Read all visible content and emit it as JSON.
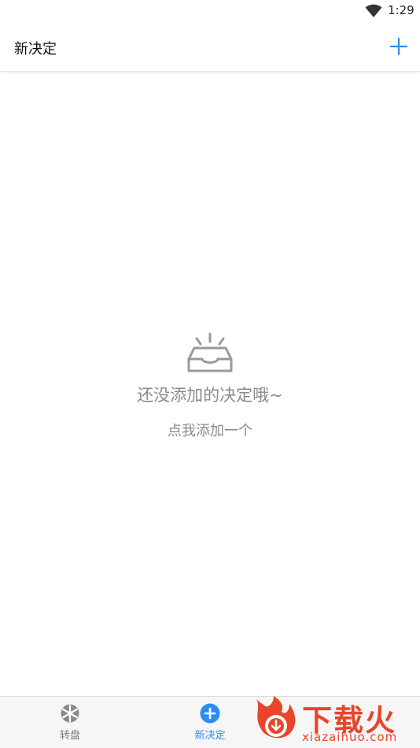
{
  "status_bar": {
    "time": "1:29"
  },
  "app_bar": {
    "title": "新决定"
  },
  "empty_state": {
    "title": "还没添加的决定哦~",
    "action_label": "点我添加一个"
  },
  "tabs": [
    {
      "label": "转盘",
      "icon": "wheel-icon",
      "active": false
    },
    {
      "label": "新决定",
      "icon": "plus-circle-icon",
      "active": true
    }
  ],
  "watermark": {
    "title": "下载火",
    "domain": "xiazaihuo.com"
  },
  "colors": {
    "accent": "#2a8ef5",
    "muted_text": "#8a8a8a",
    "tab_inactive": "#7a7a7a",
    "watermark": "#e8452b"
  }
}
